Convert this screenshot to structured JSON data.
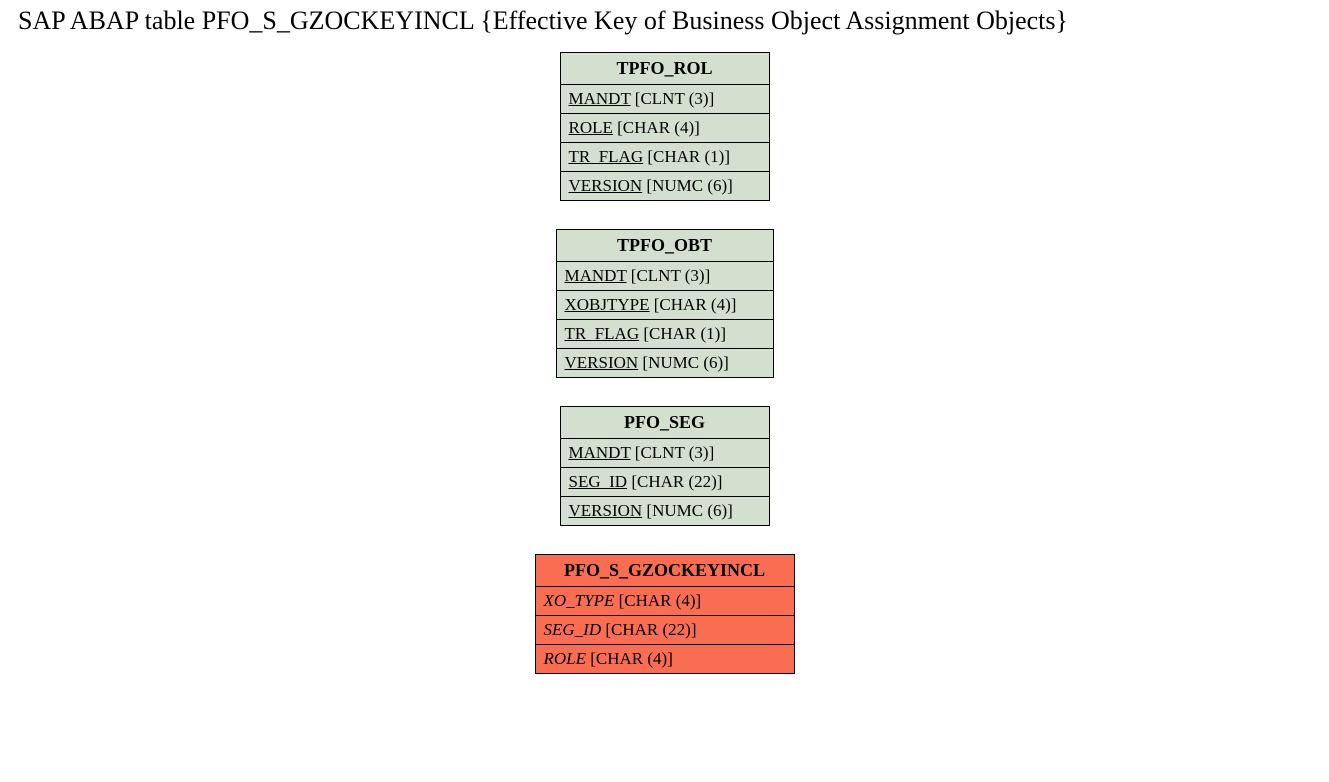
{
  "title": "SAP ABAP table PFO_S_GZOCKEYINCL {Effective Key of Business Object Assignment Objects}",
  "entities": [
    {
      "name": "TPFO_ROL",
      "theme": "green",
      "italicFields": false,
      "fields": [
        {
          "field": "MANDT",
          "type": " [CLNT (3)]"
        },
        {
          "field": "ROLE",
          "type": " [CHAR (4)]"
        },
        {
          "field": "TR_FLAG",
          "type": " [CHAR (1)]"
        },
        {
          "field": "VERSION",
          "type": " [NUMC (6)]"
        }
      ]
    },
    {
      "name": "TPFO_OBT",
      "theme": "green",
      "italicFields": false,
      "fields": [
        {
          "field": "MANDT",
          "type": " [CLNT (3)]"
        },
        {
          "field": "XOBJTYPE",
          "type": " [CHAR (4)]"
        },
        {
          "field": "TR_FLAG",
          "type": " [CHAR (1)]"
        },
        {
          "field": "VERSION",
          "type": " [NUMC (6)]"
        }
      ]
    },
    {
      "name": "PFO_SEG",
      "theme": "green",
      "italicFields": false,
      "fields": [
        {
          "field": "MANDT",
          "type": " [CLNT (3)]"
        },
        {
          "field": "SEG_ID",
          "type": " [CHAR (22)]"
        },
        {
          "field": "VERSION",
          "type": " [NUMC (6)]"
        }
      ]
    },
    {
      "name": "PFO_S_GZOCKEYINCL",
      "theme": "red",
      "italicFields": true,
      "fields": [
        {
          "field": "XO_TYPE",
          "type": " [CHAR (4)]"
        },
        {
          "field": "SEG_ID",
          "type": " [CHAR (22)]"
        },
        {
          "field": "ROLE",
          "type": " [CHAR (4)]"
        }
      ]
    }
  ]
}
